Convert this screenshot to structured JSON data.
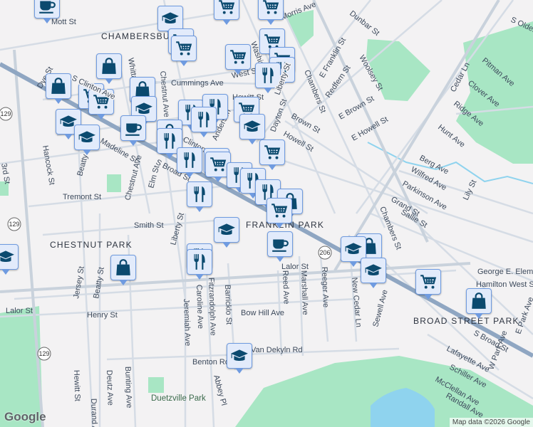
{
  "areas": {
    "chambersburg": "CHAMBERSBURG",
    "franklin_park": "FRANKLIN PARK",
    "chestnut_park": "CHESTNUT PARK",
    "broad_street_park": "BROAD STREET PARK",
    "duetzville_park": "Duetzville Park",
    "school": "George E. Elementary",
    "hamilton_west": "Hamilton West School"
  },
  "streets": {
    "morris": "Morris Ave",
    "mott": "Mott St",
    "cummings": "Cummings Ave",
    "west": "West St",
    "hewitt": "Hewitt St",
    "dunbar": "Dunbar St",
    "e_franklin": "E Franklin St",
    "redfern": "Redfern St",
    "woolsey": "Woolsey St",
    "chambers": "Chambers St",
    "chambers2": "Chambers St",
    "e_brown": "E Brown St",
    "brown": "Brown St",
    "dayton": "Dayton St",
    "howell": "Howell St",
    "e_howell": "E Howell St",
    "cedar": "Cedar Ln",
    "pitman": "Pitman Ave",
    "clover": "Clover Ave",
    "ridge": "Ridge Ave",
    "hunt": "Hunt Ave",
    "berg": "Berg Ave",
    "wilfred": "Wilfred Ave",
    "parkinson": "Parkinson Ave",
    "lily": "Lily St",
    "grand": "Grand St",
    "sallie": "Sallie St",
    "s_broad": "S Broad St",
    "s_broad2": "S Broad St",
    "clinton": "Clinton",
    "s_clinton": "S Clinton Ave",
    "hancock": "Hancock St",
    "beatty": "Beatty St",
    "madeline": "Madeline St",
    "chestnut": "Chestnut Ave",
    "chestnut2": "Chestnut Ave",
    "elm": "Elm St",
    "tremont": "Tremont St",
    "smith": "Smith St",
    "liberty": "Liberty St",
    "liberty2": "Liberty St",
    "lalor": "Lalor St",
    "lalor2": "Lalor St",
    "henry": "Henry St",
    "bow_hill": "Bow Hill Ave",
    "reed": "Reed Ave",
    "marshall": "Marshall Ave",
    "reeger": "Reeger Ave",
    "new_cedar": "New Cedar Ln",
    "sewell": "Sewell Ave",
    "lafayette": "Lafayette Ave",
    "schiller": "Schiller Ave",
    "mcclellan": "McClellan Ave",
    "randall": "Randall Ave",
    "w_park": "W Park Ave",
    "e_park": "E Park Ave",
    "jersey": "Jersey St",
    "beatty2": "Beatty St",
    "hewitt2": "Hewitt St",
    "deutz": "Deutz Ave",
    "durand": "Durand Ave",
    "bunting": "Bunting Ave",
    "jeremiah": "Jeremiah Ave",
    "caroline": "Caroline Ave",
    "fitzrandolph": "Fitzrandolph Ave",
    "barricklo": "Barricklo St",
    "benton": "Benton Rd",
    "dekyln": "Van Dekyln Rd",
    "abbey": "Abbey Pl",
    "s_olden": "S Olden",
    "anderson": "Anderson",
    "third": "3rd St",
    "dye": "Dye St",
    "whittaker": "Whittaker",
    "washington": "Washington"
  },
  "shields": {
    "r129": "129",
    "r129b": "129",
    "r129c": "129",
    "r206": "206"
  },
  "branding": {
    "logo": "Google",
    "attribution": "Map data ©2026 Google"
  },
  "colors": {
    "marker_bg": "#e2ebfb",
    "marker_border": "#6f9be0",
    "icon": "#0b4a6f",
    "park": "#a8e6c4",
    "water": "#8fd3ee",
    "arterial": "#8fa6c2"
  }
}
